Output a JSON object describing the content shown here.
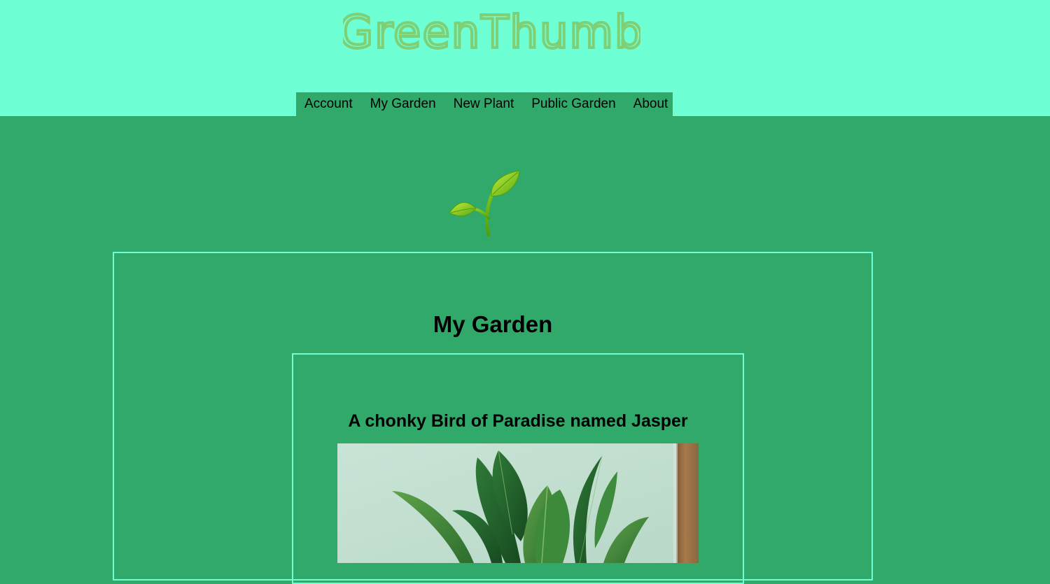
{
  "header": {
    "logo_text": "GreenThumb",
    "nav": [
      {
        "label": "Account"
      },
      {
        "label": "My Garden"
      },
      {
        "label": "New Plant"
      },
      {
        "label": "Public Garden"
      },
      {
        "label": "About"
      }
    ]
  },
  "hero": {
    "icon": "seedling-icon"
  },
  "garden": {
    "title": "My Garden",
    "plants": [
      {
        "title": "A chonky Bird of Paradise named Jasper",
        "image": "bird-of-paradise-photo"
      }
    ]
  },
  "colors": {
    "header_bg": "#6fffd5",
    "page_bg": "#31a96a",
    "logo": "#7fcf75",
    "border": "#6fffd5"
  }
}
